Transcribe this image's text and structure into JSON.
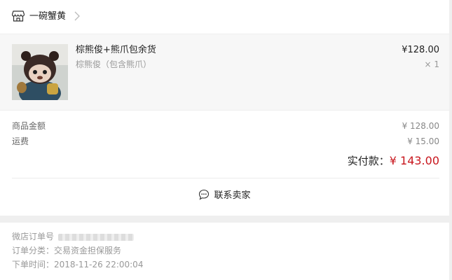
{
  "shop": {
    "name": "一碗蟹黄",
    "icon": "store-icon"
  },
  "item": {
    "title": "棕熊俊+熊爪包余货",
    "spec": "棕熊俊（包含熊爪）",
    "price": "¥128.00",
    "qty": "× 1"
  },
  "summary": {
    "goods_label": "商品金额",
    "goods_value": "¥ 128.00",
    "shipping_label": "运费",
    "shipping_value": "¥ 15.00",
    "total_label": "实付款：",
    "total_value": "¥ 143.00",
    "contact_label": "联系卖家"
  },
  "meta": {
    "order_no_label": "微店订单号",
    "order_type": "订单分类：交易资金担保服务",
    "order_time": "下单时间：2018-11-26 22:00:04"
  },
  "colors": {
    "accent": "#c8161d",
    "background": "#efefef"
  }
}
